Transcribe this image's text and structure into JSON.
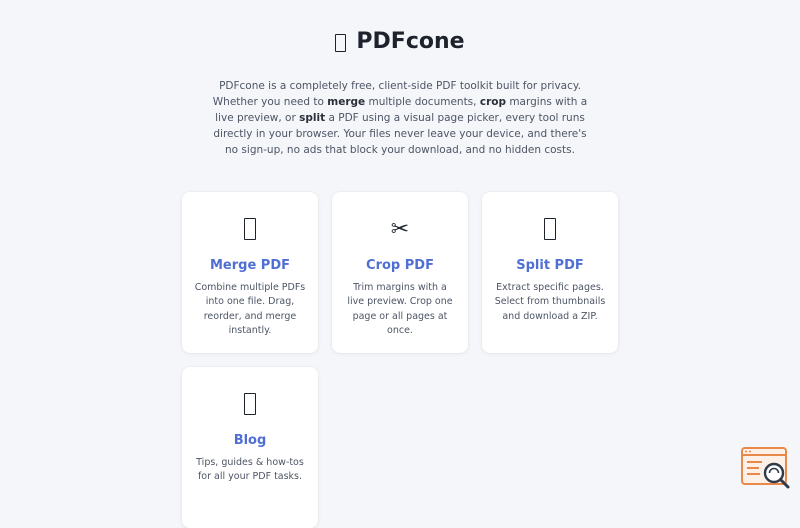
{
  "header": {
    "title_icon": "page-icon",
    "title": "PDFcone"
  },
  "intro": {
    "part1": "PDFcone is a completely free, client-side PDF toolkit built for privacy. Whether you need to ",
    "merge": "merge",
    "part2": " multiple documents, ",
    "crop": "crop",
    "part3": " margins with a live preview, or ",
    "split": "split",
    "part4": " a PDF using a visual page picker, every tool runs directly in your browser. Your files never leave your device, and there's no sign-up, no ads that block your download, and no hidden costs."
  },
  "cards": [
    {
      "icon": "page-icon",
      "title": "Merge PDF",
      "description": "Combine multiple PDFs into one file. Drag, reorder, and merge instantly."
    },
    {
      "icon": "scissors-icon",
      "glyph": "✂",
      "title": "Crop PDF",
      "description": "Trim margins with a live preview. Crop one page or all pages at once."
    },
    {
      "icon": "page-icon",
      "title": "Split PDF",
      "description": "Extract specific pages. Select from thumbnails and download a ZIP."
    },
    {
      "icon": "page-icon",
      "title": "Blog",
      "description": "Tips, guides & how-tos for all your PDF tasks."
    }
  ],
  "colors": {
    "background": "#f4f6f9",
    "card_title": "#4f6fd4",
    "body_text": "#4d5565",
    "heading": "#1d222c",
    "watermark": "#e8894a"
  },
  "watermark": {
    "icon": "search-document-icon"
  }
}
